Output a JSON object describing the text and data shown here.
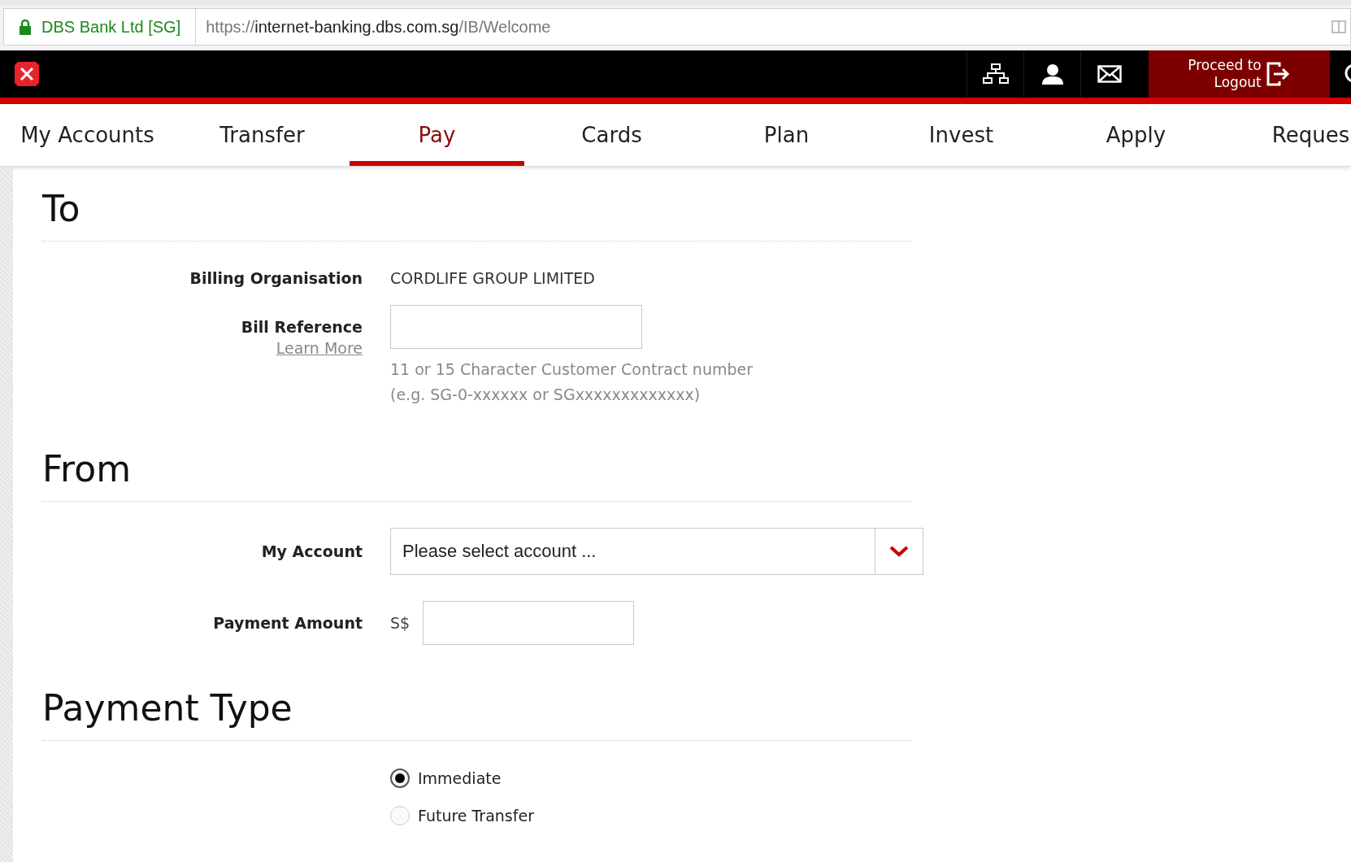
{
  "address_bar": {
    "site_identity": "DBS Bank Ltd [SG]",
    "url_scheme": "https://",
    "url_host": "internet-banking.dbs.com.sg",
    "url_path": "/IB/Welcome"
  },
  "top_bar": {
    "logout_button": [
      "Proceed to",
      "Logout"
    ]
  },
  "tabs": [
    {
      "label": "My Accounts",
      "selected": false
    },
    {
      "label": "Transfer",
      "selected": false
    },
    {
      "label": "Pay",
      "selected": true
    },
    {
      "label": "Cards",
      "selected": false
    },
    {
      "label": "Plan",
      "selected": false
    },
    {
      "label": "Invest",
      "selected": false
    },
    {
      "label": "Apply",
      "selected": false
    },
    {
      "label": "Reques",
      "selected": false
    }
  ],
  "to_section": {
    "title": "To",
    "billing_organisation": {
      "label": "Billing Organisation",
      "value": "CORDLIFE GROUP LIMITED"
    },
    "bill_reference": {
      "label": "Bill Reference",
      "link": "Learn More",
      "hint": [
        "11 or 15 Character Customer Contract number",
        "(e.g. SG-0-xxxxxx or SGxxxxxxxxxxxxx)"
      ]
    }
  },
  "from_section": {
    "title": "From",
    "my_account": {
      "label": "My Account",
      "placeholder": "Please select account ..."
    },
    "payment_amount": {
      "label": "Payment Amount",
      "currency": "S$"
    }
  },
  "payment_type": {
    "title": "Payment Type",
    "options": [
      {
        "label": "Immediate",
        "selected": true
      },
      {
        "label": "Future Transfer",
        "selected": false
      }
    ]
  }
}
